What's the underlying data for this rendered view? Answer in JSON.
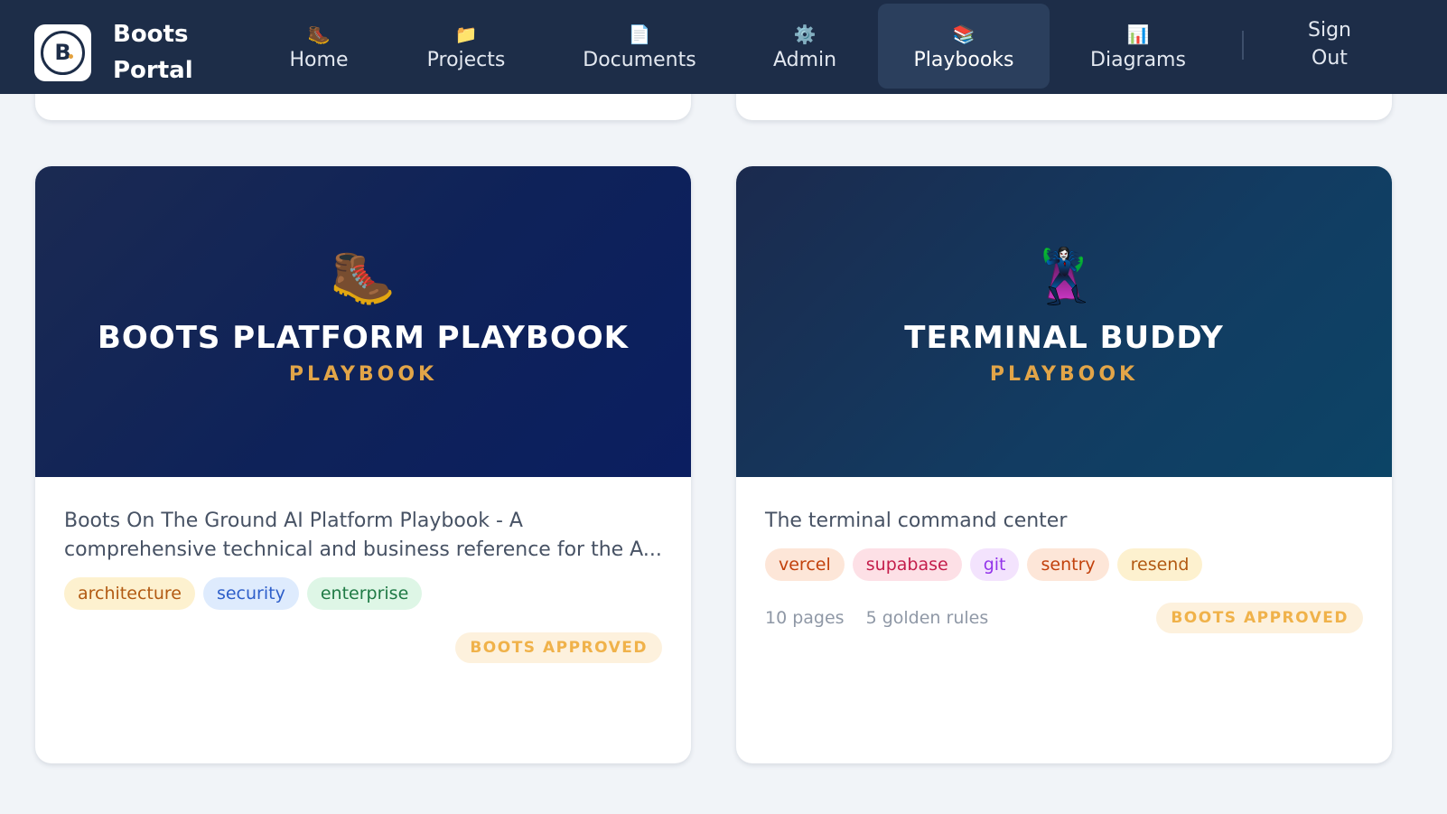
{
  "brand": {
    "line1": "Boots",
    "line2": "Portal",
    "logo_letter": "B"
  },
  "nav": {
    "items": [
      {
        "icon": "🥾",
        "icon_name": "boot-icon",
        "label": "Home"
      },
      {
        "icon": "📁",
        "icon_name": "folder-icon",
        "label": "Projects"
      },
      {
        "icon": "📄",
        "icon_name": "document-icon",
        "label": "Documents"
      },
      {
        "icon": "⚙️",
        "icon_name": "gear-icon",
        "label": "Admin"
      },
      {
        "icon": "📚",
        "icon_name": "books-icon",
        "label": "Playbooks"
      },
      {
        "icon": "📊",
        "icon_name": "bar-chart-icon",
        "label": "Diagrams"
      }
    ],
    "active": "Playbooks",
    "signout_line1": "Sign",
    "signout_line2": "Out"
  },
  "cards": [
    {
      "emoji": "🥾",
      "title": "BOOTS PLATFORM PLAYBOOK",
      "subtitle": "PLAYBOOK",
      "description": "Boots On The Ground AI Platform Playbook - A comprehensive technical and business reference for the A...",
      "tags": [
        "architecture",
        "security",
        "enterprise"
      ],
      "badge": "BOOTS APPROVED"
    },
    {
      "emoji": "🦹‍♀️",
      "title": "TERMINAL BUDDY",
      "subtitle": "PLAYBOOK",
      "description": "The terminal command center",
      "tags": [
        "vercel",
        "supabase",
        "git",
        "sentry",
        "resend"
      ],
      "pages": "10 pages",
      "rules": "5 golden rules",
      "badge": "BOOTS APPROVED"
    }
  ],
  "colors": {
    "nav_bg": "#1d2d48",
    "accent_gold": "#e2a548",
    "page_bg": "#f1f4f8"
  }
}
